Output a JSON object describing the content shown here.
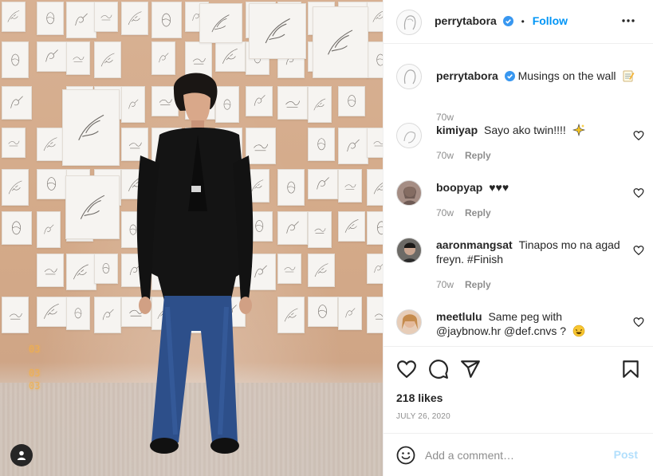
{
  "post": {
    "author": "perrytabora",
    "follow_label": "Follow",
    "dot": "•",
    "caption_author": "perrytabora",
    "caption_text": "Musings on the wall",
    "caption_emoji": "memo-icon",
    "caption_time": "70w",
    "likes": "218 likes",
    "date": "JULY 26, 2020",
    "photo_date_stamp": [
      "03",
      "03",
      "03"
    ]
  },
  "comments": [
    {
      "user": "kimiyap",
      "text": "Sayo ako twin!!!!",
      "emoji": "sparkles-icon",
      "time": "70w",
      "reply": "Reply"
    },
    {
      "user": "boopyap",
      "text": "♥♥♥",
      "emoji": "",
      "time": "70w",
      "reply": "Reply"
    },
    {
      "user": "aaronmangsat",
      "text": "Tinapos mo na agad freyn. #Finish",
      "emoji": "",
      "time": "70w",
      "reply": "Reply"
    },
    {
      "user": "meetlulu",
      "text": "Same peg with @jaybnow.hr @def.cnvs ?",
      "emoji": "laughing-icon",
      "time": "",
      "reply": ""
    }
  ],
  "composer": {
    "placeholder": "Add a comment…",
    "post_label": "Post"
  },
  "colors": {
    "accent": "#0095f6",
    "verified": "#3897f0",
    "muted": "#8e8e8e",
    "post_disabled": "#b2dffc"
  }
}
